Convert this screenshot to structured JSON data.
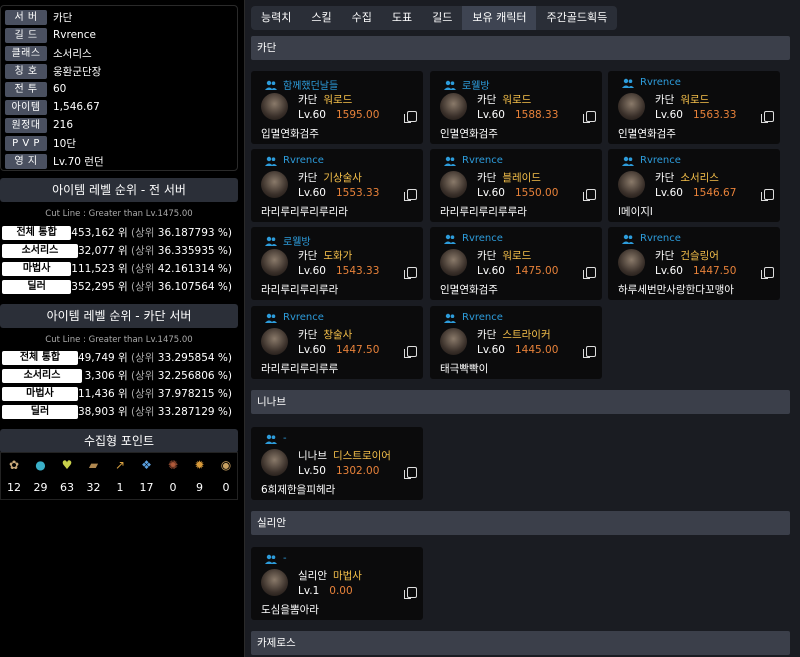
{
  "profile": {
    "rows": [
      {
        "label": "서 버",
        "value": "카단"
      },
      {
        "label": "길 드",
        "value": "Rvrence"
      },
      {
        "label": "클래스",
        "value": "소서리스"
      },
      {
        "label": "칭 호",
        "value": "웅환군단장"
      },
      {
        "label": "전 투",
        "value": "60"
      },
      {
        "label": "아이템",
        "value": "1,546.67"
      },
      {
        "label": "원정대",
        "value": "216"
      },
      {
        "label": "P V P",
        "value": "10단"
      },
      {
        "label": "영 지",
        "value": "Lv.70 런던"
      }
    ]
  },
  "rank_all": {
    "title": "아이템 레벨 순위 - 전 서버",
    "cutline": "Cut Line : Greater than Lv.1475.00",
    "rows": [
      {
        "label": "전체 통합",
        "rank": "453,162 위",
        "pre": "(상위",
        "pct": "36.187793 %)"
      },
      {
        "label": "소서리스",
        "rank": "32,077 위",
        "pre": "(상위",
        "pct": "36.335935 %)"
      },
      {
        "label": "마법사",
        "rank": "111,523 위",
        "pre": "(상위",
        "pct": "42.161314 %)"
      },
      {
        "label": "딜러",
        "rank": "352,295 위",
        "pre": "(상위",
        "pct": "36.107564 %)"
      }
    ]
  },
  "rank_server": {
    "title": "아이템 레벨 순위 - 카단 서버",
    "cutline": "Cut Line : Greater than Lv.1475.00",
    "rows": [
      {
        "label": "전체 통합",
        "rank": "49,749 위",
        "pre": "(상위",
        "pct": "33.295854 %)"
      },
      {
        "label": "소서리스",
        "rank": "3,306 위",
        "pre": "(상위",
        "pct": "32.256806 %)"
      },
      {
        "label": "마법사",
        "rank": "11,436 위",
        "pre": "(상위",
        "pct": "37.978215 %)"
      },
      {
        "label": "딜러",
        "rank": "38,903 위",
        "pre": "(상위",
        "pct": "33.287129 %)"
      }
    ]
  },
  "collect": {
    "title": "수집형 포인트",
    "items": [
      {
        "icon": "mokoko-seed-icon",
        "glyph": "✿",
        "color": "#c9a97a",
        "count": "12"
      },
      {
        "icon": "island-heart-icon",
        "glyph": "●",
        "color": "#3ab0c8",
        "count": "29"
      },
      {
        "icon": "giant-heart-icon",
        "glyph": "♥",
        "color": "#c8d04a",
        "count": "63"
      },
      {
        "icon": "art-icon",
        "glyph": "▰",
        "color": "#b08850",
        "count": "32"
      },
      {
        "icon": "grand-prix-icon",
        "glyph": "↗",
        "color": "#d8a040",
        "count": "1"
      },
      {
        "icon": "ignea-token-icon",
        "glyph": "❖",
        "color": "#5aa0e0",
        "count": "17"
      },
      {
        "icon": "sea-bounty-icon",
        "glyph": "✺",
        "color": "#b05a3a",
        "count": "0"
      },
      {
        "icon": "world-tree-leaf-icon",
        "glyph": "✹",
        "color": "#d89a3a",
        "count": "9"
      },
      {
        "icon": "orpheus-star-icon",
        "glyph": "◉",
        "color": "#c8a060",
        "count": "0"
      }
    ]
  },
  "tabs": [
    "능력치",
    "스킬",
    "수집",
    "도표",
    "길드",
    "보유 캐릭터",
    "주간골드획득"
  ],
  "active_tab": 5,
  "servers": [
    {
      "name": "카단",
      "characters": [
        {
          "account": "함께했던날들",
          "server": "카단",
          "class": "워로드",
          "level": "Lv.60",
          "ilvl": "1595.00",
          "name": "입멸연화검주"
        },
        {
          "account": "로웰방",
          "server": "카단",
          "class": "워로드",
          "level": "Lv.60",
          "ilvl": "1588.33",
          "name": "인멸연화검주"
        },
        {
          "account": "Rvrence",
          "server": "카단",
          "class": "워로드",
          "level": "Lv.60",
          "ilvl": "1563.33",
          "name": "인멸연화검주"
        },
        {
          "account": "Rvrence",
          "server": "카단",
          "class": "기상술사",
          "level": "Lv.60",
          "ilvl": "1553.33",
          "name": "라리루리루리루리라"
        },
        {
          "account": "Rvrence",
          "server": "카단",
          "class": "블레이드",
          "level": "Lv.60",
          "ilvl": "1550.00",
          "name": "라리루리루리루루라"
        },
        {
          "account": "Rvrence",
          "server": "카단",
          "class": "소서리스",
          "level": "Lv.60",
          "ilvl": "1546.67",
          "name": "l메이지l"
        },
        {
          "account": "로웰방",
          "server": "카단",
          "class": "도화가",
          "level": "Lv.60",
          "ilvl": "1543.33",
          "name": "라리루리루리루라"
        },
        {
          "account": "Rvrence",
          "server": "카단",
          "class": "워로드",
          "level": "Lv.60",
          "ilvl": "1475.00",
          "name": "인멸연화검주"
        },
        {
          "account": "Rvrence",
          "server": "카단",
          "class": "건슬링어",
          "level": "Lv.60",
          "ilvl": "1447.50",
          "name": "하루세번만사랑한다꼬맹아"
        },
        {
          "account": "Rvrence",
          "server": "카단",
          "class": "창술사",
          "level": "Lv.60",
          "ilvl": "1447.50",
          "name": "라리루리루리루루"
        },
        {
          "account": "Rvrence",
          "server": "카단",
          "class": "스트라이커",
          "level": "Lv.60",
          "ilvl": "1445.00",
          "name": "태극빡빡이"
        }
      ]
    },
    {
      "name": "니나브",
      "characters": [
        {
          "account": "-",
          "server": "니나브",
          "class": "디스트로이어",
          "level": "Lv.50",
          "ilvl": "1302.00",
          "name": "6희제한을피헤라"
        }
      ]
    },
    {
      "name": "실리안",
      "characters": [
        {
          "account": "-",
          "server": "실리안",
          "class": "마법사",
          "level": "Lv.1",
          "ilvl": "0.00",
          "name": "도심을뽐아라"
        }
      ]
    },
    {
      "name": "카제로스",
      "characters": []
    }
  ],
  "colors": {
    "account": "#2d9cdb",
    "class": "#f5c04a",
    "ilvl": "#e8823a"
  }
}
